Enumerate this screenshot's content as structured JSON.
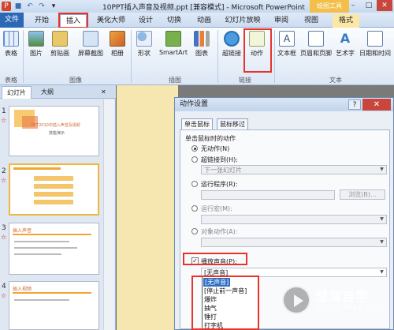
{
  "window": {
    "title": "10PPT插入声音及视频.ppt [兼容模式] - Microsoft PowerPoint",
    "context_tab_title": "绘图工具",
    "minimize": "–",
    "maximize": "□",
    "close": "✕"
  },
  "quick_access": {
    "app_icon": "P",
    "save": "■",
    "undo": "↶",
    "redo": "↷",
    "customize": "▾"
  },
  "tabs": [
    "文件",
    "开始",
    "插入",
    "美化大师",
    "设计",
    "切换",
    "动画",
    "幻灯片放映",
    "审阅",
    "视图",
    "格式"
  ],
  "ribbon": {
    "buttons": [
      "表格",
      "图片",
      "剪贴画",
      "屏幕截图",
      "相册",
      "形状",
      "SmartArt",
      "图表",
      "超链接",
      "动作",
      "文本框",
      "页眉和页脚",
      "艺术字",
      "日期和时间"
    ],
    "groups": [
      "表格",
      "图像",
      "插图",
      "链接",
      "文本"
    ]
  },
  "left_pane": {
    "tabs": [
      "幻灯片",
      "大纲"
    ],
    "close": "✕",
    "slides": [
      {
        "num": "1",
        "mark": "☆"
      },
      {
        "num": "2",
        "mark": "☆"
      },
      {
        "num": "3",
        "mark": "☆"
      },
      {
        "num": "4",
        "mark": "☆"
      }
    ],
    "thumb1_title": "PPT2010中插入声音及视频",
    "thumb1_sub": "技能演示",
    "thumb3_title": "插入声音",
    "thumb4_title": "插入视频"
  },
  "dialog": {
    "title": "动作设置",
    "help": "?",
    "close": "✕",
    "tabs": [
      "单击鼠标",
      "鼠标移过"
    ],
    "section_label": "单击鼠标时的动作",
    "options": {
      "none": "无动作(N)",
      "hyperlink": "超链接到(H):",
      "hyperlink_value": "下一张幻灯片",
      "run_program": "运行程序(R):",
      "browse": "浏览(B)...",
      "run_macro": "运行宏(M):",
      "object_action": "对象动作(A):",
      "play_sound": "播放声音(P):",
      "sound_value": "[无声音]"
    },
    "sound_list": [
      "[无声音]",
      "[停止前一声音]",
      "爆炸",
      "抽气",
      "锤打",
      "打字机"
    ]
  },
  "watermark": {
    "name": "溜溜自学",
    "url": "ZIXUE.3D66.COM"
  },
  "colors": {
    "accent_red": "#e8322b",
    "file_tab": "#2b68b6",
    "highlight": "#2e6fc4",
    "context_tab": "#f2c04a"
  }
}
